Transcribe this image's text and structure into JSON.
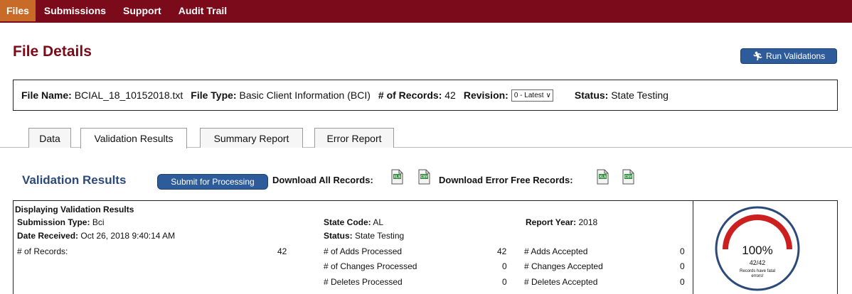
{
  "nav": {
    "items": [
      "Files",
      "Submissions",
      "Support",
      "Audit Trail"
    ]
  },
  "page": {
    "title": "File Details",
    "run_validations_label": "Run Validations"
  },
  "file_info": {
    "file_name_label": "File Name:",
    "file_name": "BCIAL_18_10152018.txt",
    "file_type_label": "File Type:",
    "file_type": "Basic Client Information (BCI)",
    "records_label": "# of Records:",
    "records": "42",
    "revision_label": "Revision:",
    "revision_selected": "0 - Latest",
    "status_label": "Status:",
    "status": "State Testing"
  },
  "tabs": [
    "Data",
    "Validation Results",
    "Summary Report",
    "Error Report"
  ],
  "active_tab": "Validation Results",
  "validation": {
    "title": "Validation Results",
    "submit_label": "Submit for Processing",
    "download_all_label": "Download All Records:",
    "download_error_free_label": "Download Error Free Records:",
    "icons": {
      "xls": "XLS",
      "csv": "CSV"
    }
  },
  "results": {
    "heading": "Displaying Validation Results",
    "submission_type_label": "Submission Type:",
    "submission_type": "Bci",
    "date_received_label": "Date Received:",
    "date_received": "Oct 26, 2018 9:40:14 AM",
    "records_label": "# of Records:",
    "records_value": "42",
    "state_code_label": "State Code:",
    "state_code": "AL",
    "status_label": "Status:",
    "status": "State Testing",
    "report_year_label": "Report Year:",
    "report_year": "2018",
    "adds_processed_label": "# of Adds Processed",
    "adds_processed": "42",
    "changes_processed_label": "# of Changes Processed",
    "changes_processed": "0",
    "deletes_processed_label": "# Deletes Processed",
    "deletes_processed": "0",
    "adds_accepted_label": "# Adds Accepted",
    "adds_accepted": "0",
    "changes_accepted_label": "# Changes Accepted",
    "changes_accepted": "0",
    "deletes_accepted_label": "# Deletes Accepted",
    "deletes_accepted": "0"
  },
  "gauge": {
    "percent_text": "100%",
    "ratio_text": "42/42",
    "caption": "Records have fatal errors!",
    "fraction": 1.0
  },
  "colors": {
    "brand": "#7b0a1a",
    "active_nav": "#c86a28",
    "button": "#2e5c9b",
    "title_blue": "#2b4a7a",
    "gauge_red": "#cc1f1f",
    "gauge_ring": "#2b4a7a"
  }
}
